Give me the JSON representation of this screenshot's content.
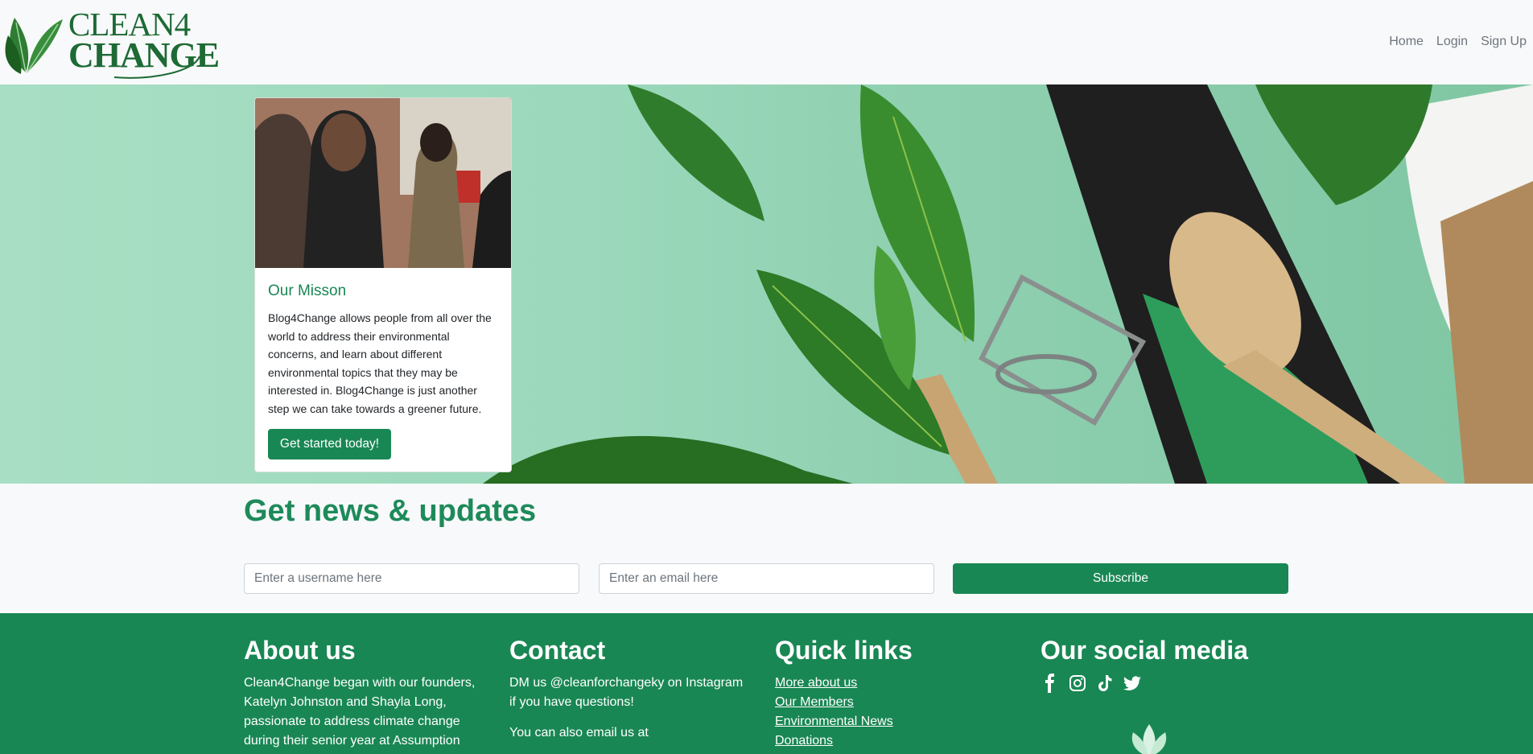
{
  "brand": {
    "line1": "CLEAN4",
    "line2": "CHANGE"
  },
  "nav": {
    "home": "Home",
    "login": "Login",
    "signup": "Sign Up"
  },
  "mission": {
    "title": "Our Misson",
    "text": "Blog4Change allows people from all over the world to address their environmental concerns, and learn about different environmental topics that they may be interested in. Blog4Change is just another step we can take towards a greener future.",
    "button": "Get started today!"
  },
  "news": {
    "title": "Get news & updates",
    "username_placeholder": "Enter a username here",
    "email_placeholder": "Enter an email here",
    "subscribe": "Subscribe"
  },
  "footer": {
    "about": {
      "title": "About us",
      "text": "Clean4Change began with our founders, Katelyn Johnston and Shayla Long, passionate to address climate change during their senior year at Assumption"
    },
    "contact": {
      "title": "Contact",
      "text1": "DM us @cleanforchangeky on Instagram if you have questions!",
      "text2": "You can also email us at"
    },
    "links": {
      "title": "Quick links",
      "items": [
        "More about us",
        "Our Members",
        "Environmental News",
        "Donations"
      ]
    },
    "social": {
      "title": "Our social media",
      "icons": [
        "facebook-icon",
        "instagram-icon",
        "tiktok-icon",
        "twitter-icon"
      ]
    }
  },
  "colors": {
    "primary": "#198754",
    "logo": "#1d6a35"
  }
}
